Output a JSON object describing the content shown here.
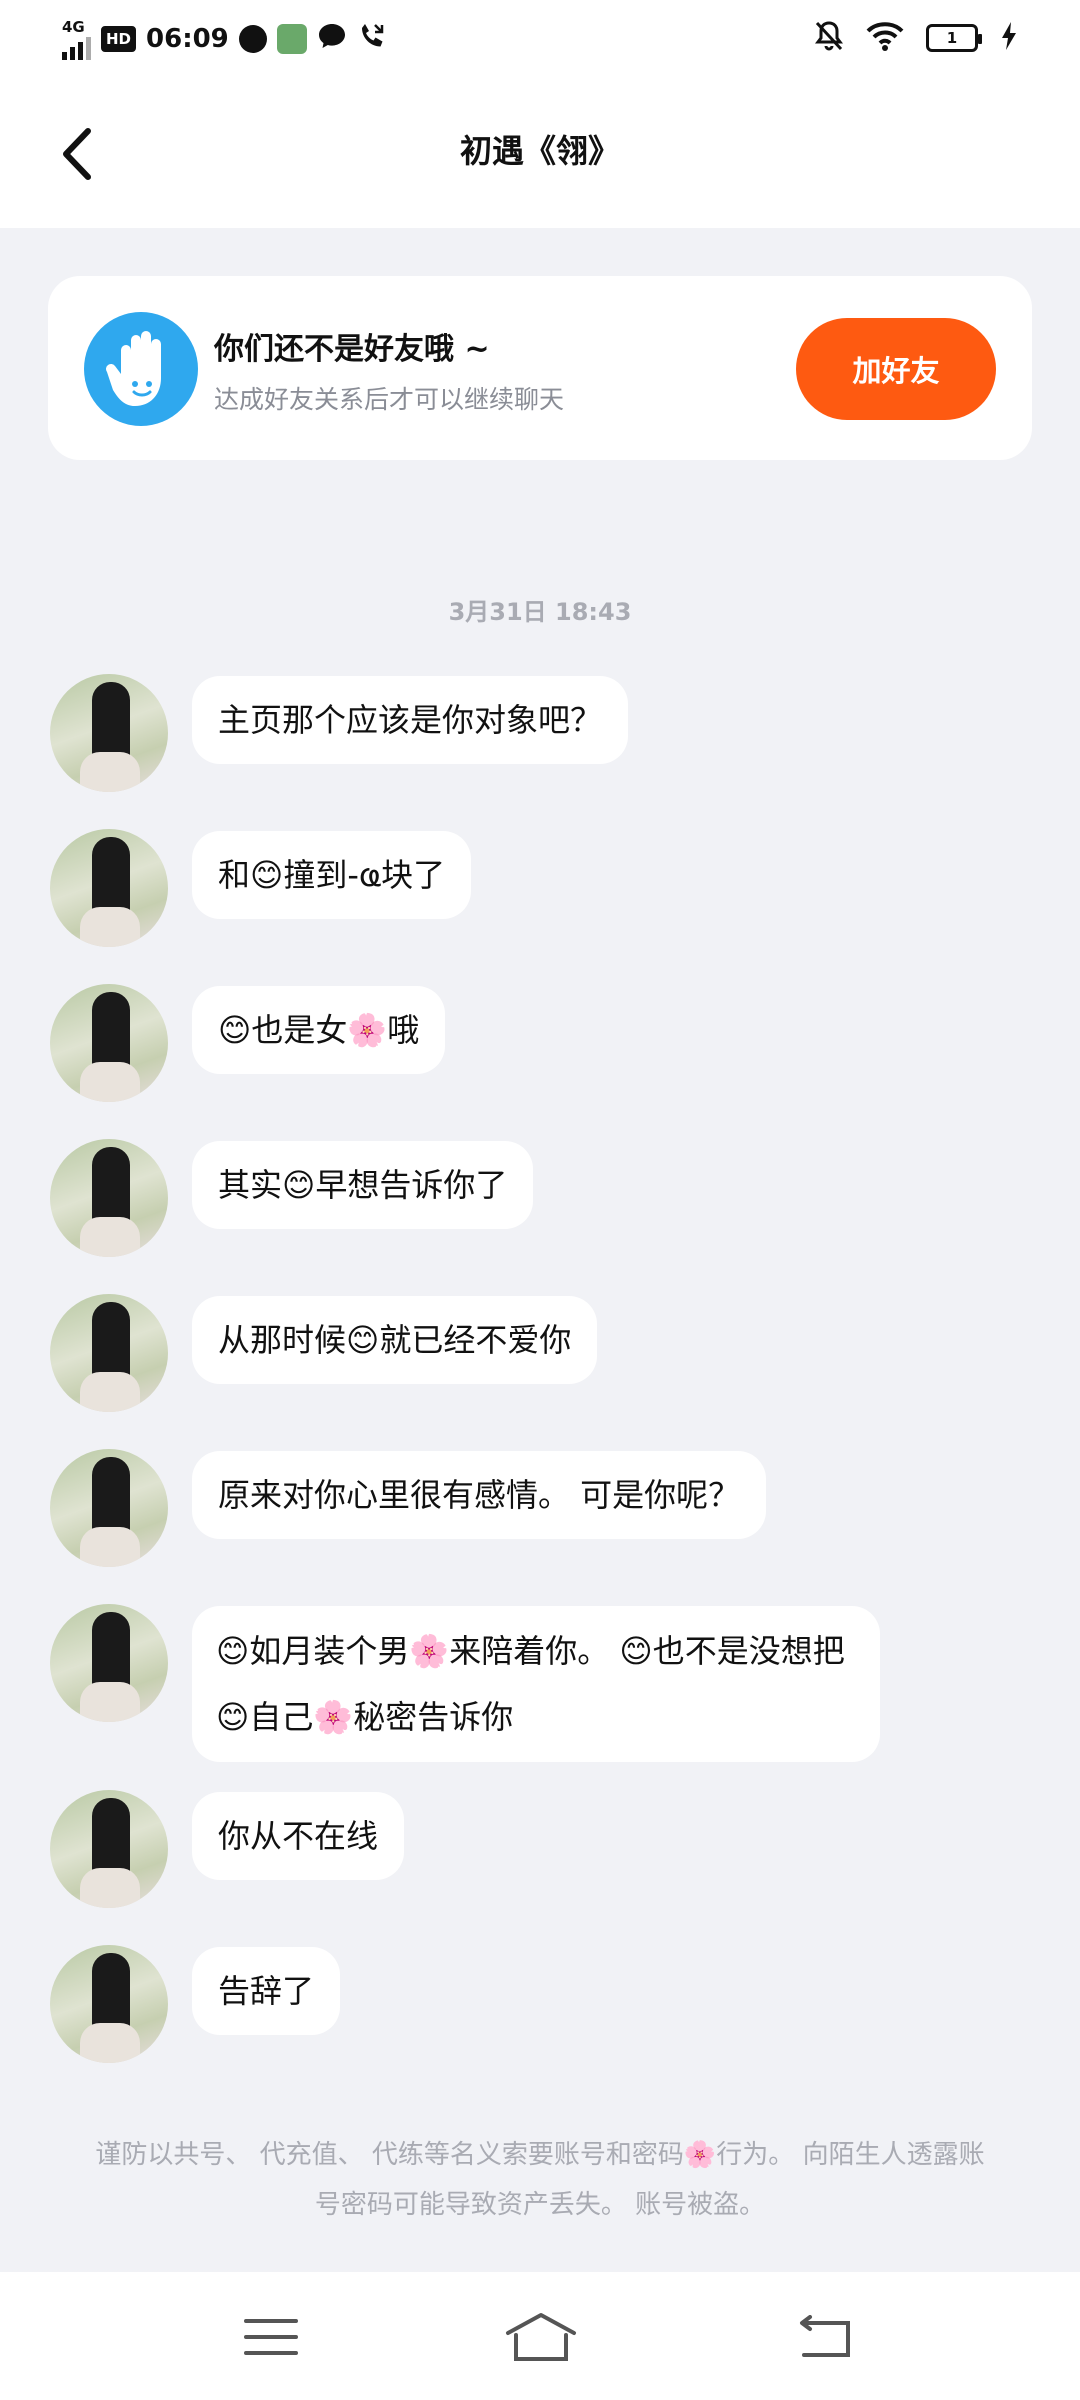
{
  "status_bar": {
    "network": "4G",
    "hd": "HD",
    "time": "06:09",
    "battery": "1",
    "icons": [
      "signal-icon",
      "wechat-icon",
      "app-icon",
      "message-icon",
      "phone-icon",
      "mute-icon",
      "wifi-icon",
      "battery-icon",
      "charging-icon"
    ]
  },
  "header": {
    "title": "初遇《翎》",
    "back_icon": "chevron-left-icon"
  },
  "friend_banner": {
    "title": "你们还不是好友哦 ~",
    "subtitle": "达成好友关系后才可以继续聊天",
    "button": "加好友",
    "icon": "hand-icon",
    "colors": {
      "button": "#fe5a11",
      "icon_bg": "#2fa8ee"
    }
  },
  "timestamp": "3月31日  18:43",
  "messages": [
    {
      "text": "主页那个应该是你对象吧？"
    },
    {
      "text": "和😊撞到-ҩ块了"
    },
    {
      "text": "😊也是女🌸哦"
    },
    {
      "text": "其实😊早想告诉你了"
    },
    {
      "text": "从那时候😊就已经不爱你"
    },
    {
      "text": "原来对你心里很有感情。 可是你呢？"
    },
    {
      "text": "😊如月装个男🌸来陪着你。 😊也不是没想把😊自己🌸秘密告诉你"
    },
    {
      "text": "你从不在线"
    },
    {
      "text": "告辞了"
    }
  ],
  "notice": "谨防以共号、 代充值、 代练等名义索要账号和密码🌸行为。 向陌生人透露账号密码可能导致资产丢失。 账号被盗。",
  "nav_bar": {
    "icons": [
      "menu-icon",
      "home-icon",
      "back-icon"
    ]
  }
}
